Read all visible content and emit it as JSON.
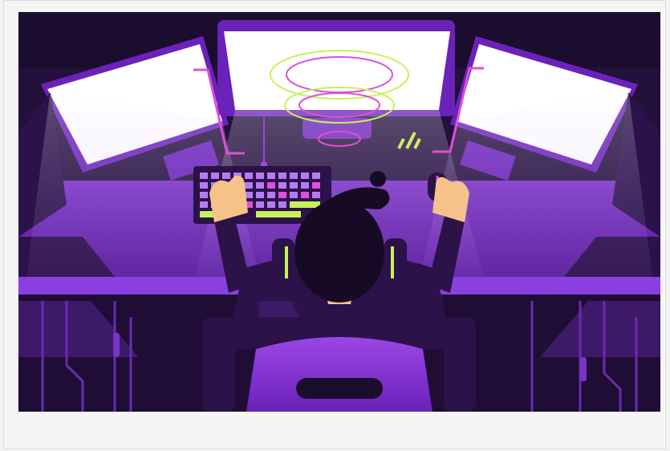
{
  "image": {
    "subject": "gamer-at-three-monitor-desk-illustration",
    "colors": {
      "background_dark": "#1b0d2e",
      "purple_primary": "#7a2bd0",
      "purple_light": "#9b46e6",
      "monitor_screen": "#ffffff",
      "neon_green": "#c7f25a",
      "neon_pink": "#e04fd6",
      "skin": "#f5c28a",
      "hair": "#170a24",
      "card_bg": "#f5f5f5"
    },
    "icons": [
      "monitor-icon",
      "keyboard-icon",
      "mouse-icon",
      "headphones-icon",
      "gaming-chair-icon"
    ]
  }
}
